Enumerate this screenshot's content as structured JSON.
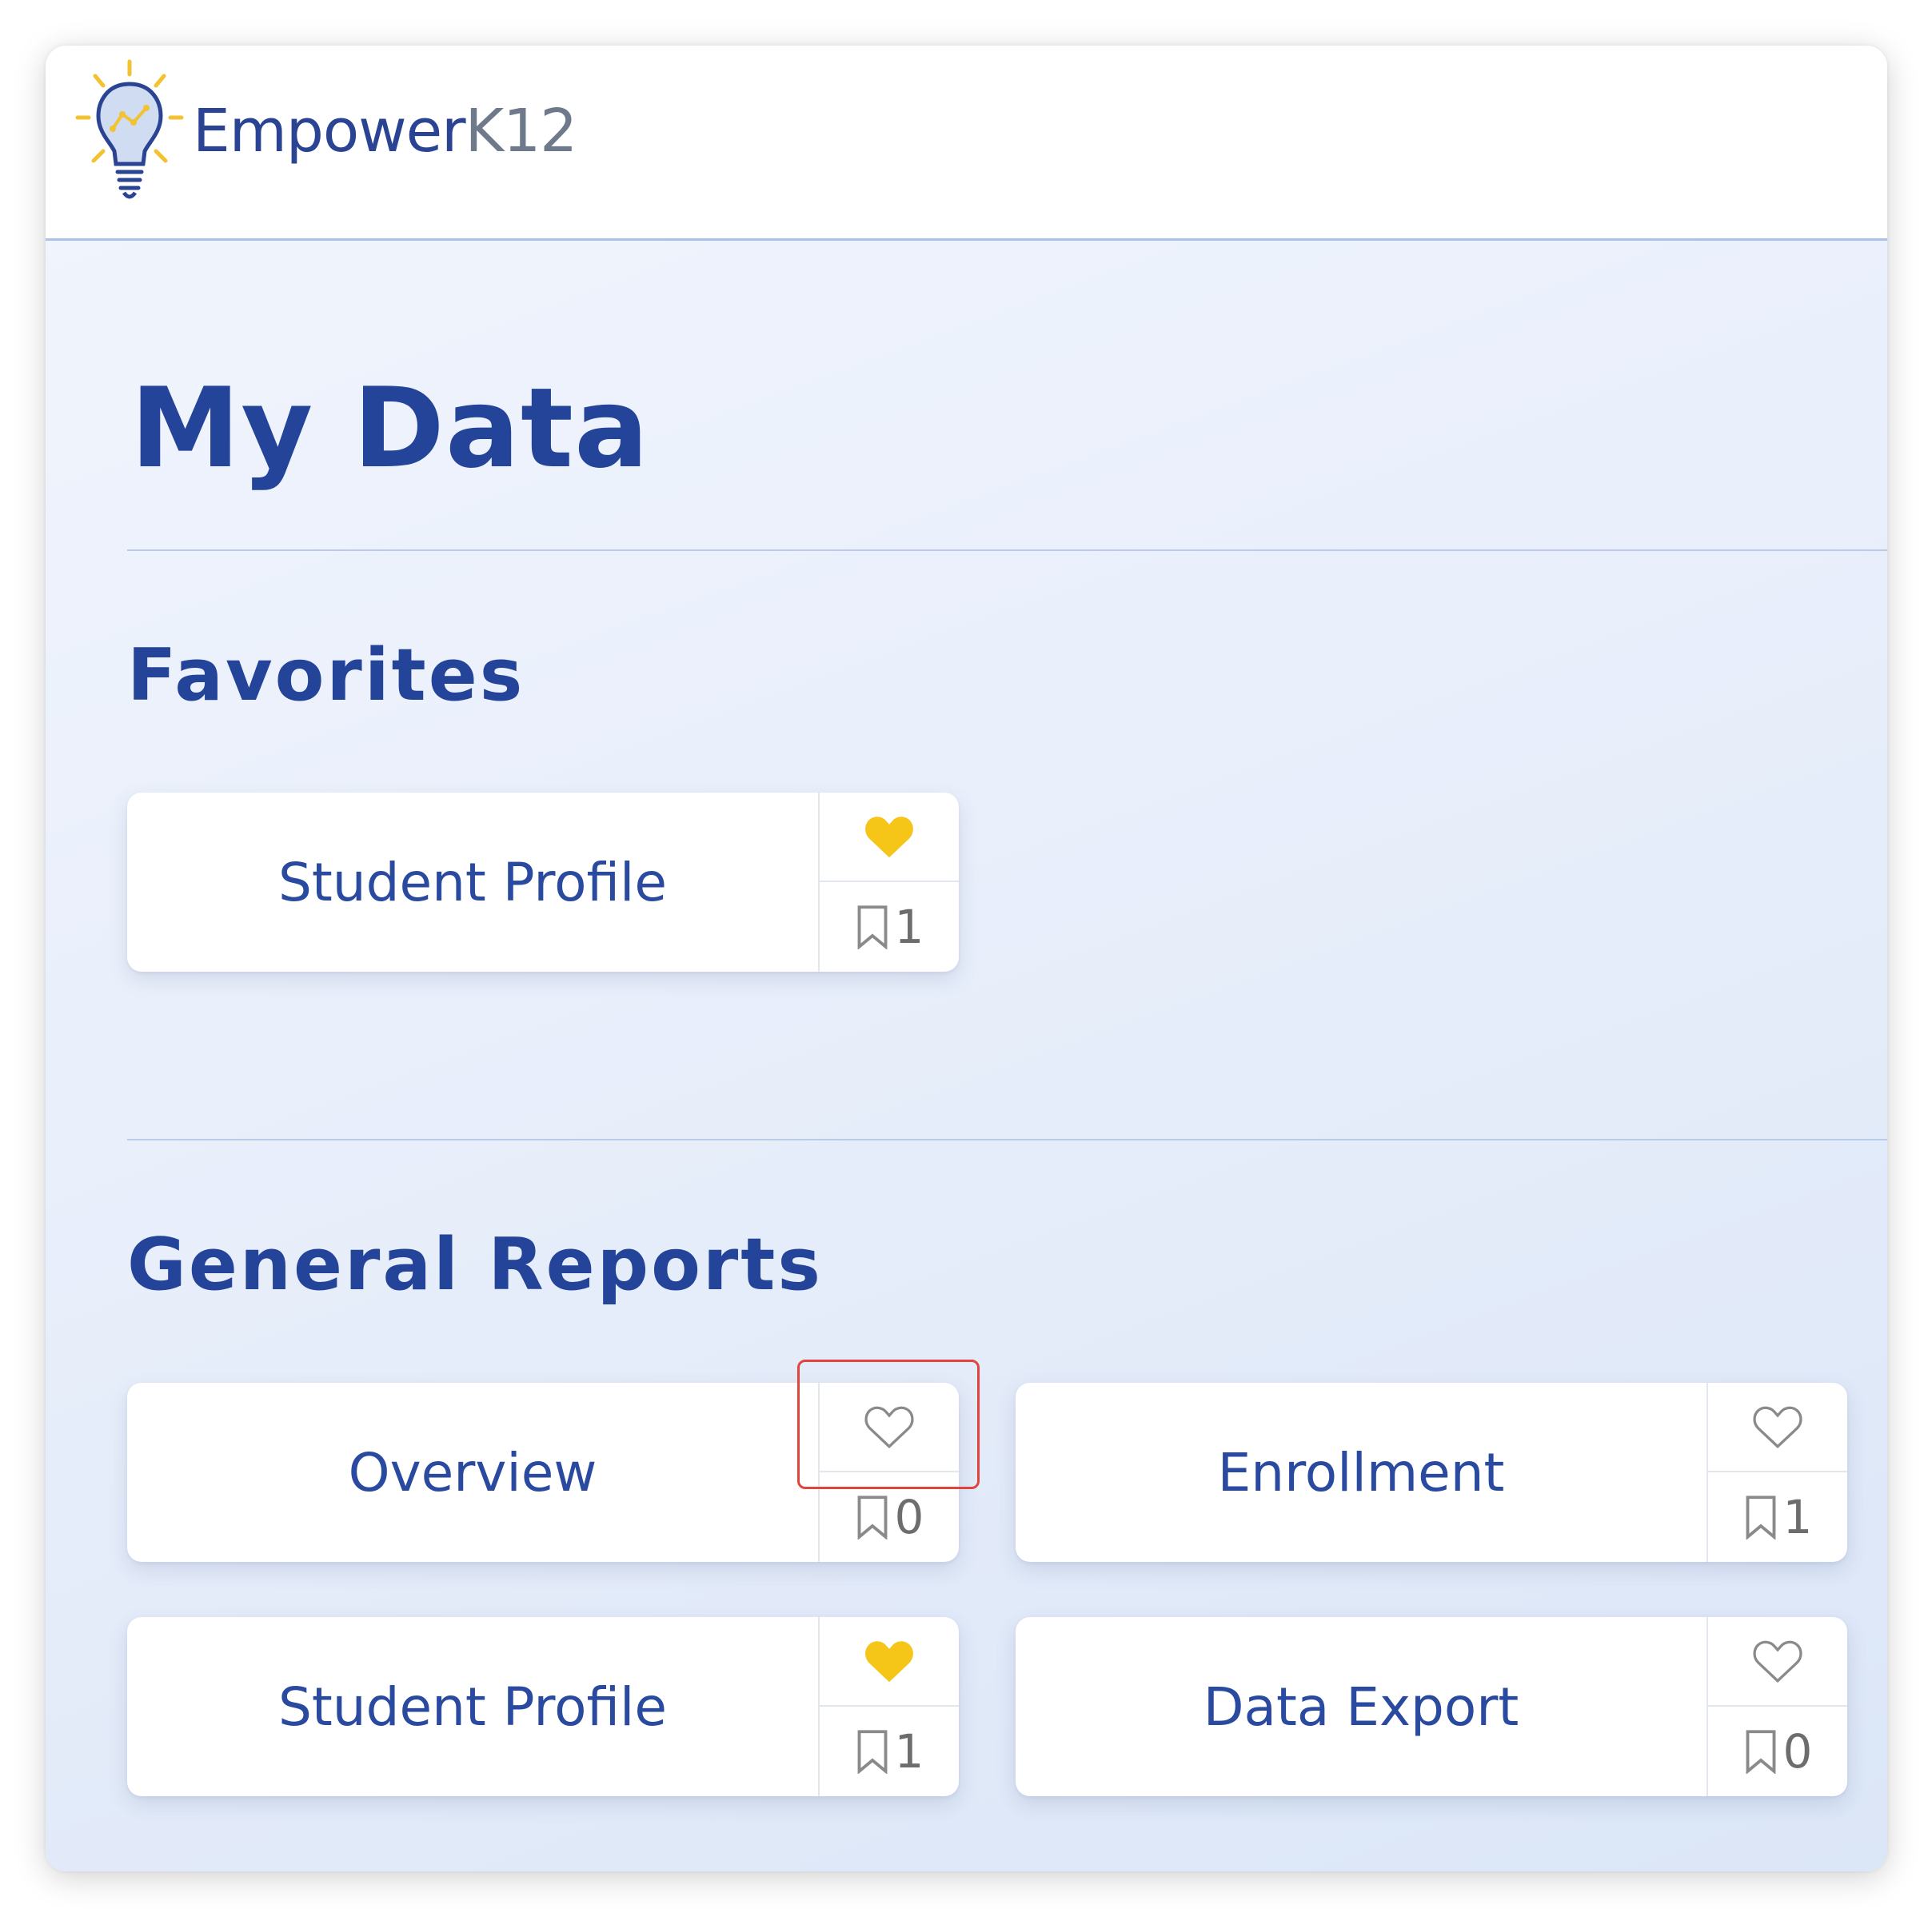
{
  "header": {
    "logo_text_primary": "Empower",
    "logo_text_secondary": "K12",
    "logo_icon": "lightbulb-icon"
  },
  "page": {
    "title": "My Data"
  },
  "favorites": {
    "title": "Favorites",
    "cards": [
      {
        "label": "Student Profile",
        "favorited": true,
        "bookmark_count": "1"
      }
    ]
  },
  "general_reports": {
    "title": "General Reports",
    "cards": [
      {
        "label": "Overview",
        "favorited": false,
        "bookmark_count": "0"
      },
      {
        "label": "Enrollment",
        "favorited": false,
        "bookmark_count": "1"
      },
      {
        "label": "Student Profile",
        "favorited": true,
        "bookmark_count": "1"
      },
      {
        "label": "Data Export",
        "favorited": false,
        "bookmark_count": "0"
      }
    ]
  },
  "colors": {
    "brand_blue": "#24449a",
    "favorite_gold": "#f5c518",
    "highlight_red": "#e0443c"
  }
}
